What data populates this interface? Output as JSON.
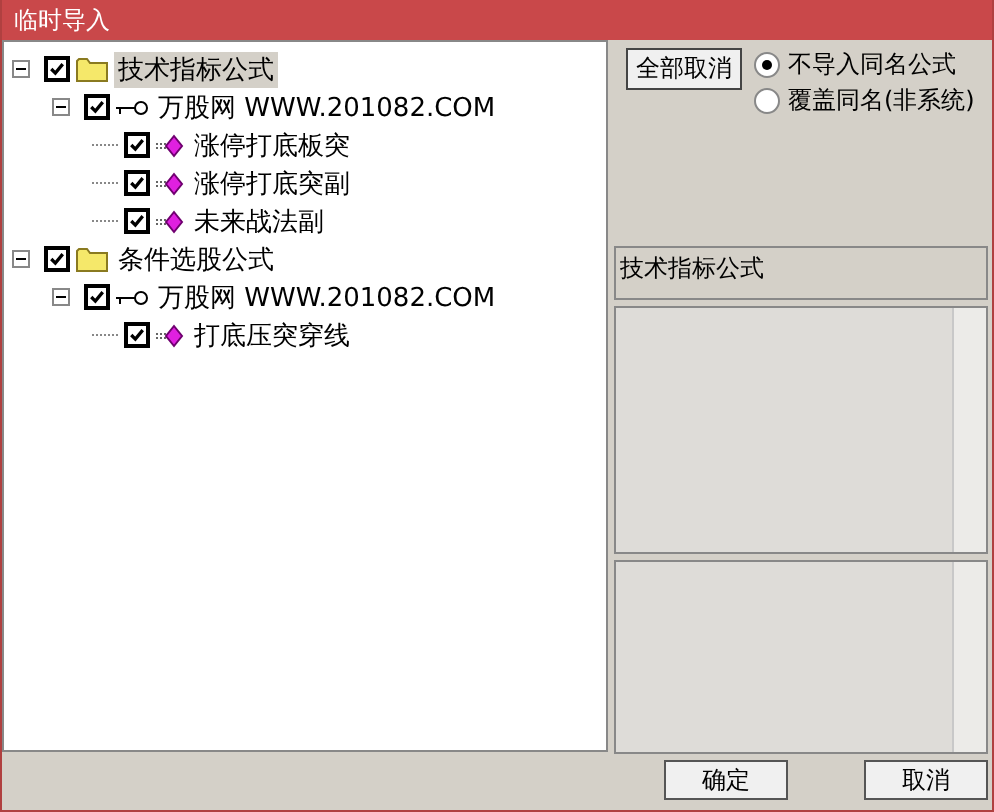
{
  "window": {
    "title": "临时导入"
  },
  "tree": [
    {
      "label": "技术指标公式",
      "kind": "folder",
      "checked": true,
      "expanded": true,
      "selected": true,
      "children": [
        {
          "label": "万股网 WWW.201082.COM",
          "kind": "key",
          "checked": true,
          "expanded": true,
          "selected": false,
          "children": [
            {
              "label": "涨停打底板突",
              "kind": "formula",
              "checked": true,
              "selected": false
            },
            {
              "label": "涨停打底突副",
              "kind": "formula",
              "checked": true,
              "selected": false
            },
            {
              "label": "未来战法副",
              "kind": "formula",
              "checked": true,
              "selected": false
            }
          ]
        }
      ]
    },
    {
      "label": "条件选股公式",
      "kind": "folder",
      "checked": true,
      "expanded": true,
      "selected": false,
      "children": [
        {
          "label": "万股网 WWW.201082.COM",
          "kind": "key",
          "checked": true,
          "expanded": true,
          "selected": false,
          "children": [
            {
              "label": "打底压突穿线",
              "kind": "formula",
              "checked": true,
              "selected": false
            }
          ]
        }
      ]
    }
  ],
  "cancel_all_button": "全部取消",
  "options": [
    {
      "label": "不导入同名公式",
      "selected": true
    },
    {
      "label": "覆盖同名(非系统)",
      "selected": false
    }
  ],
  "category_label": "技术指标公式",
  "buttons": [
    "确定",
    "取消"
  ]
}
